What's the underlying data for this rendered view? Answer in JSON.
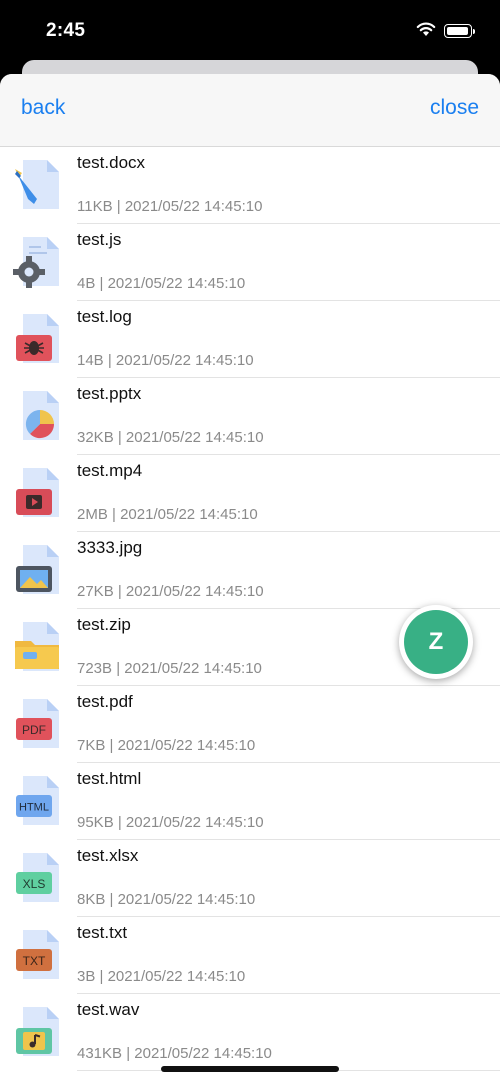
{
  "status_bar": {
    "time": "2:45"
  },
  "nav": {
    "back_label": "back",
    "close_label": "close"
  },
  "files": [
    {
      "name": "test.docx",
      "meta": "11KB | 2021/05/22 14:45:10",
      "icon": "word-document-icon"
    },
    {
      "name": "test.js",
      "meta": "4B | 2021/05/22 14:45:10",
      "icon": "script-gear-icon"
    },
    {
      "name": "test.log",
      "meta": "14B | 2021/05/22 14:45:10",
      "icon": "log-bug-icon"
    },
    {
      "name": "test.pptx",
      "meta": "32KB | 2021/05/22 14:45:10",
      "icon": "presentation-pie-icon"
    },
    {
      "name": "test.mp4",
      "meta": "2MB | 2021/05/22 14:45:10",
      "icon": "video-play-icon"
    },
    {
      "name": "3333.jpg",
      "meta": "27KB | 2021/05/22 14:45:10",
      "icon": "image-icon"
    },
    {
      "name": "test.zip",
      "meta": "723B | 2021/05/22 14:45:10",
      "icon": "zip-folder-icon"
    },
    {
      "name": "test.pdf",
      "meta": "7KB | 2021/05/22 14:45:10",
      "icon": "pdf-icon",
      "badge": "PDF"
    },
    {
      "name": "test.html",
      "meta": "95KB | 2021/05/22 14:45:10",
      "icon": "html-icon",
      "badge": "HTML"
    },
    {
      "name": "test.xlsx",
      "meta": "8KB | 2021/05/22 14:45:10",
      "icon": "xls-icon",
      "badge": "XLS"
    },
    {
      "name": "test.txt",
      "meta": "3B | 2021/05/22 14:45:10",
      "icon": "txt-icon",
      "badge": "TXT"
    },
    {
      "name": "test.wav",
      "meta": "431KB | 2021/05/22 14:45:10",
      "icon": "audio-note-icon"
    }
  ],
  "fab": {
    "label": "Z",
    "color": "#38b085"
  },
  "colors": {
    "accent": "#1a7ff0",
    "meta_text": "#8a8a8a"
  }
}
